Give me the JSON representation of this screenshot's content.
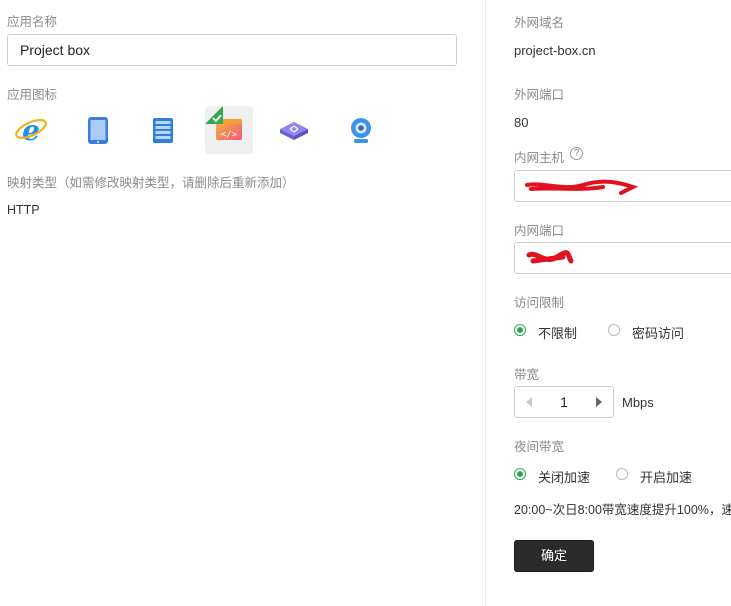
{
  "left": {
    "app_name_label": "应用名称",
    "app_name_value": "Project box",
    "app_icon_label": "应用图标",
    "icons": [
      {
        "name": "ie-browser-icon"
      },
      {
        "name": "tablet-icon"
      },
      {
        "name": "server-icon"
      },
      {
        "name": "code-window-icon",
        "selected": true
      },
      {
        "name": "router-icon"
      },
      {
        "name": "webcam-icon"
      }
    ],
    "mapping_type_label": "映射类型（如需修改映射类型，请删除后重新添加）",
    "mapping_type_value": "HTTP"
  },
  "right": {
    "domain_label": "外网域名",
    "domain_value": "project-box.cn",
    "ext_port_label": "外网端口",
    "ext_port_value": "80",
    "int_host_label": "内网主机",
    "help_icon_glyph": "?",
    "int_port_label": "内网端口",
    "access_label": "访问限制",
    "access_options": [
      "不限制",
      "密码访问"
    ],
    "bandwidth_label": "带宽",
    "bandwidth_value": "1",
    "bandwidth_unit": "Mbps",
    "night_label": "夜间带宽",
    "night_options": [
      "关闭加速",
      "开启加速"
    ],
    "night_note": "20:00~次日8:00带宽速度提升100%，速",
    "confirm_label": "确定"
  },
  "colors": {
    "accent_green": "#2fa84f",
    "button_dark": "#2b2b2b",
    "redaction_red": "#e3101f"
  }
}
